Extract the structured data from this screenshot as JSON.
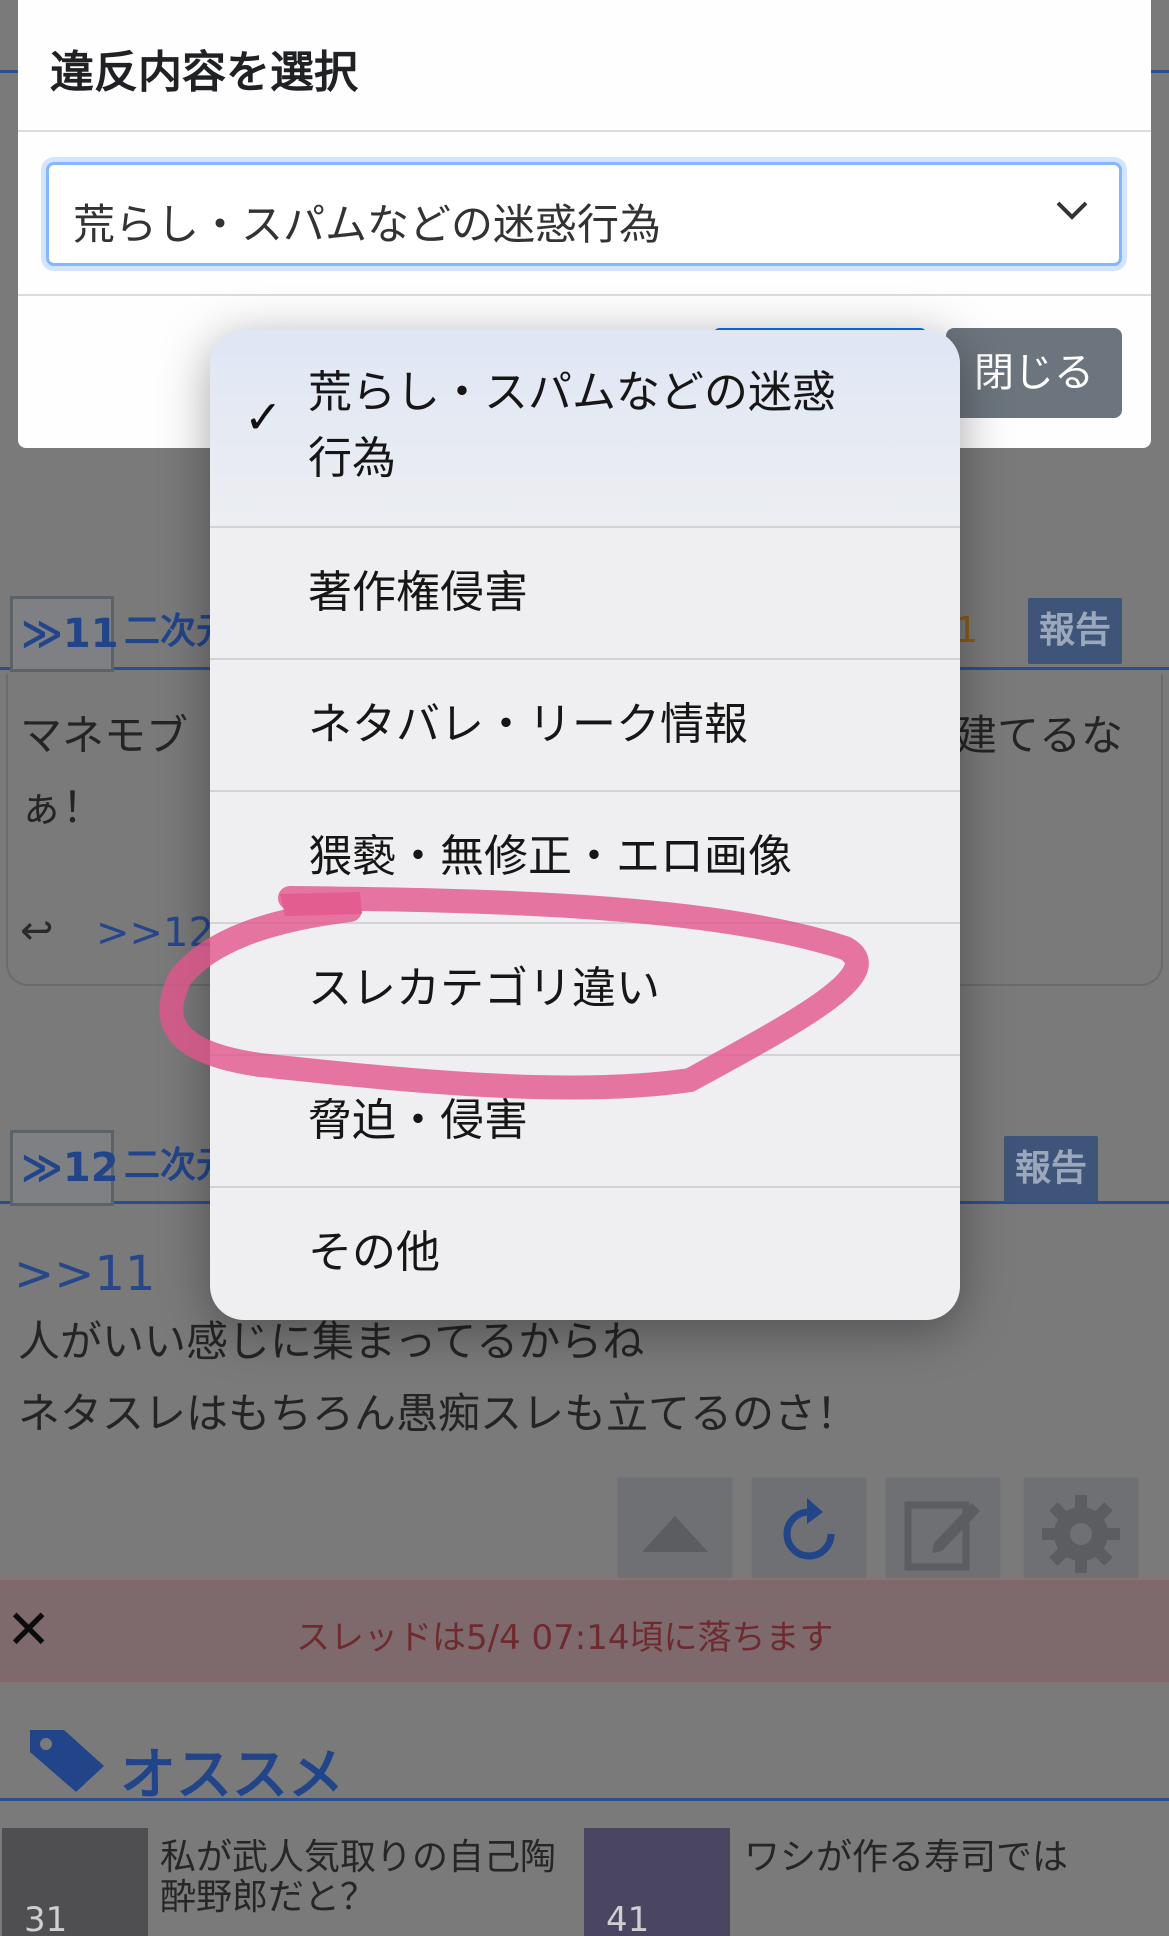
{
  "background": {
    "posts": [
      {
        "number": "≫11",
        "name_fragment": "二次元",
        "id_fragment": "1",
        "report_label": "報告",
        "body_lines": [
          "マネモブ",
          "ぁ！"
        ],
        "body_right_fragment": "建てるな",
        "reply_link": ">>12"
      },
      {
        "number": "≫12",
        "name_fragment": "二次元",
        "report_label": "報告",
        "quote_link": ">>11",
        "body_lines": [
          "人がいい感じに集まってるからね",
          "ネタスレはもちろん愚痴スレも立てるのさ！"
        ]
      }
    ],
    "toolbar_icons": [
      "scroll-up-icon",
      "reload-icon",
      "edit-icon",
      "settings-icon"
    ],
    "drop_notice": {
      "text": "スレッドは5/4 07:14頃に落ちます",
      "close_glyph": "✕"
    },
    "recommend": {
      "heading": "オススメ",
      "items": [
        {
          "title": "私が武人気取りの自己陶酔野郎だと？",
          "count": "31"
        },
        {
          "title": "ワシが作る寿司では",
          "count": "41"
        }
      ]
    }
  },
  "modal": {
    "title": "違反内容を選択",
    "select_value": "荒らし・スパムなどの迷惑行為",
    "close_label": "閉じる"
  },
  "picker": {
    "selected_index": 0,
    "check_glyph": "✓",
    "options": [
      "荒らし・スパムなどの迷惑行為",
      "著作権侵害",
      "ネタバレ・リーク情報",
      "猥褻・無修正・エロ画像",
      "スレカテゴリ違い",
      "脅迫・侵害",
      "その他"
    ],
    "selected_line1": "荒らし・スパムなどの迷惑",
    "selected_line2": "行為"
  },
  "colors": {
    "accent": "#0d6efd",
    "link_blue": "#22458a",
    "annotation_pink": "#e2558c",
    "close_button": "#6c757d"
  }
}
